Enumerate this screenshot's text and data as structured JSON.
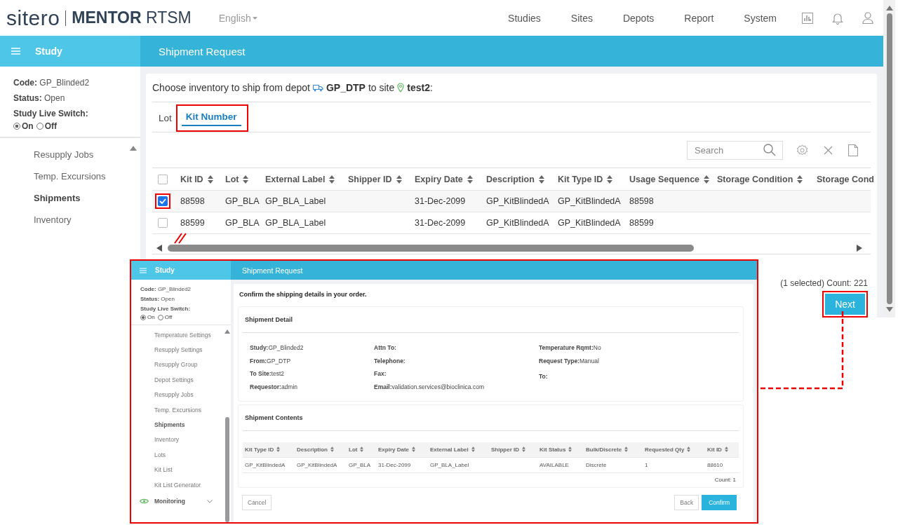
{
  "header": {
    "logo": "sitero",
    "product": "**MENTOR** RTSM",
    "language": "English",
    "nav": [
      "Studies",
      "Sites",
      "Depots",
      "Report",
      "System"
    ]
  },
  "sidebar": {
    "title": "Study",
    "fields": [
      {
        "label": "Code:",
        "value": "GP_Blinded2"
      },
      {
        "label": "Status:",
        "value": "Open"
      }
    ],
    "switch_label": "Study Live Switch:",
    "switch_options": [
      {
        "label": "On",
        "selected": true
      },
      {
        "label": "Off",
        "selected": false
      }
    ],
    "items": [
      {
        "label": "Resupply Jobs",
        "selected": false
      },
      {
        "label": "Temp. Excursions",
        "selected": false
      },
      {
        "label": "Shipments",
        "selected": true
      },
      {
        "label": "Inventory",
        "selected": false
      }
    ]
  },
  "page_title": "Shipment Request",
  "instruction": {
    "prefix": "Choose inventory to ship from depot",
    "depot": "GP_DTP",
    "middle": "to site",
    "site": "**test2**:"
  },
  "tabs": [
    {
      "label": "Lot",
      "selected": false,
      "highlighted": false
    },
    {
      "label": "Kit Number",
      "selected": true,
      "highlighted": true
    }
  ],
  "search": {
    "placeholder": "Search"
  },
  "table": {
    "header_checked": false,
    "columns": [
      "Kit ID",
      "Lot",
      "External Label",
      "Shipper ID",
      "Expiry Date",
      "Description",
      "Kit Type ID",
      "Usage Sequence",
      "Storage Condition",
      "Storage Cond"
    ],
    "rows": [
      {
        "selected": true,
        "highlighted": true,
        "cells": [
          "88598",
          "GP_BLA",
          "GP_BLA_Label",
          null,
          "31-Dec-2099",
          "GP_KitBlindedA",
          "GP_KitBlindedA",
          "88598"
        ]
      },
      {
        "selected": false,
        "highlighted": false,
        "cells": [
          "88599",
          "GP_BLA",
          "GP_BLA_Label",
          null,
          "31-Dec-2099",
          "GP_KitBlindedA",
          "GP_KitBlindedA",
          "88599"
        ]
      }
    ]
  },
  "selection_count": "(1 selected) Count: 221",
  "next_button": {
    "label": "Next",
    "highlighted": true
  },
  "inset": {
    "highlighted": true,
    "sidebar_title": "Study",
    "page_title": "Shipment Request",
    "fields": [
      {
        "label": "Code:",
        "value": "GP_Blinded2"
      },
      {
        "label": "Status:",
        "value": "Open"
      }
    ],
    "switch_label": "Study Live Switch:",
    "switch_options": [
      {
        "label": "On",
        "selected": true
      },
      {
        "label": "Off",
        "selected": false
      }
    ],
    "items": [
      {
        "label": "Temperature Settings",
        "selected": false
      },
      {
        "label": "Resupply Settings",
        "selected": false
      },
      {
        "label": "Resupply Group",
        "selected": false
      },
      {
        "label": "Depot Settings",
        "selected": false
      },
      {
        "label": "Resupply Jobs",
        "selected": false
      },
      {
        "label": "Temp. Excursions",
        "selected": false
      },
      {
        "label": "Shipments",
        "selected": true
      },
      {
        "label": "Inventory",
        "selected": false
      },
      {
        "label": "Lots",
        "selected": false
      },
      {
        "label": "Kit List",
        "selected": false
      },
      {
        "label": "Kit List Generator",
        "selected": false
      }
    ],
    "section": "Monitoring",
    "intro": "Confirm the shipping details in your order.",
    "detail_title": "Shipment Detail",
    "detail_columns": [
      [
        {
          "label": "Study:",
          "value": "GP_Blinded2"
        },
        {
          "label": "From:",
          "value": "GP_DTP"
        },
        {
          "label": "To Site:",
          "value": "test2"
        },
        {
          "label": "Requestor:",
          "value": "admin"
        }
      ],
      [
        {
          "label": "Attn To:"
        },
        {
          "label": "Telephone:"
        },
        {
          "label": "Fax:"
        },
        {
          "label": "Email:",
          "value": "validation.services@bioclinica.com"
        }
      ],
      [
        {
          "label": "Temperature Rqmt:",
          "value": "No"
        },
        {
          "label": "Request Type:",
          "value": "Manual"
        },
        {
          "label": "To:"
        }
      ]
    ],
    "contents_title": "Shipment Contents",
    "columns": [
      "Kit Type ID",
      "Description",
      "Lot",
      "Expiry Date",
      "External Label",
      "Shipper ID",
      "Kit Status",
      "Bulk/Discrete",
      "Requested Qty",
      "Kit ID"
    ],
    "rows": [
      [
        "GP_KitBlindedA",
        "GP_KitBlindedA",
        "GP_BLA",
        "31-Dec-2099",
        "GP_BLA_Label",
        null,
        "AVAILABLE",
        "Discrete",
        "1",
        "88610"
      ]
    ],
    "count": "Count: 1",
    "buttons": {
      "cancel": "Cancel",
      "back": "Back",
      "confirm": "Confirm"
    }
  }
}
